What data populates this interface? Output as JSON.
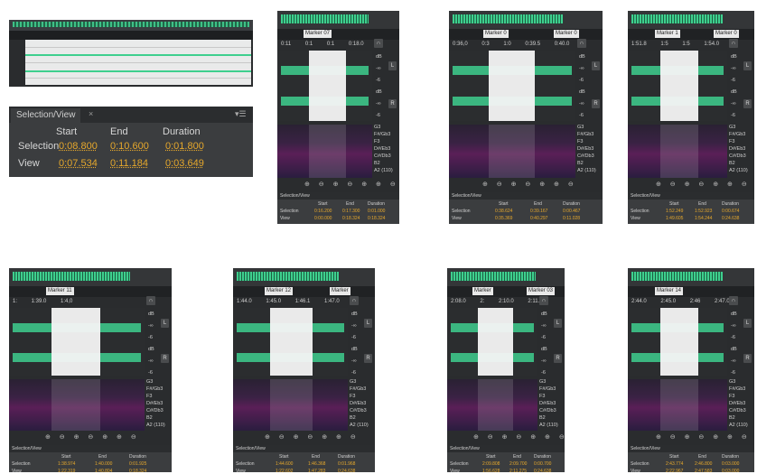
{
  "panel": {
    "tab_label": "Selection/View",
    "tab_close": "×",
    "menu": "▾☰",
    "col_start": "Start",
    "col_end": "End",
    "col_duration": "Duration",
    "row_selection": "Selection",
    "row_view": "View",
    "sel_start": "0:08.800",
    "sel_end": "0:10.600",
    "sel_duration": "0:01.800",
    "view_start": "0:07.534",
    "view_end": "0:11.184",
    "view_duration": "0:03.649"
  },
  "thumbs": [
    {
      "marker": "Marker 07",
      "ticks": [
        "0:11",
        "0:1",
        "0:1",
        "0:18.0"
      ]
    },
    {
      "marker": "Marker 0",
      "ticks": [
        "0:36,0",
        "0:3",
        "1:0",
        "0:39.5",
        "0:40.0"
      ],
      "marker2": "Marker 0"
    },
    {
      "marker": "Marker 1",
      "ticks": [
        "1:51.8",
        "1:5",
        "1:5",
        "1:54.0"
      ],
      "marker2": "Marker 0"
    },
    {
      "marker": "Marker 11",
      "ticks": [
        "1:",
        "1:39.0",
        "1:4,0"
      ]
    },
    {
      "marker": "Marker 12",
      "ticks": [
        "1:44.0",
        "1:45.0",
        "1:46.1",
        "1:47.0"
      ],
      "marker2": "Marker"
    },
    {
      "marker": "Marker",
      "ticks": [
        "2:08.0",
        "2:",
        "2:10.0",
        "2:11.0"
      ],
      "marker2": "Marker 03"
    },
    {
      "marker": "Marker 14",
      "ticks": [
        "2:44.0",
        "2:45.0",
        "2:46",
        "2:47.0"
      ]
    }
  ],
  "spec_labels": [
    "G3",
    "F#/Gb3",
    "F3",
    "D#/Eb3",
    "C#/Db3",
    "B2",
    "A2 (110)"
  ],
  "db_labels": [
    "dB",
    "-∞",
    "-6",
    "dB",
    "-∞",
    "-6"
  ],
  "zoom_icons": "⊕ ⊖ ⊕ ⊖ ⊕ ⊕ ⊖",
  "mini_panel": {
    "tab": "Selection/View",
    "start": "Start",
    "end": "End",
    "duration": "Duration",
    "selection": "Selection",
    "view": "View",
    "rows": [
      {
        "s1": "0:16.200",
        "s2": "0:17.300",
        "s3": "0:01.000",
        "v1": "0:00.000",
        "v2": "0:18.324",
        "v3": "0:18.324"
      },
      {
        "s1": "0:38.624",
        "s2": "0:39.167",
        "s3": "0:00.467",
        "v1": "0:35.369",
        "v2": "0:40.297",
        "v3": "0:11.028"
      },
      {
        "s1": "1:52.249",
        "s2": "1:52.923",
        "s3": "0:00.674",
        "v1": "1:49.605",
        "v2": "1:54.244",
        "v3": "0:24.638"
      },
      {
        "s1": "1:38.974",
        "s2": "1:40.000",
        "s3": "0:01.925",
        "v1": "1:22.319",
        "v2": "1:40.804",
        "v3": "0:18.324"
      },
      {
        "s1": "1:44.600",
        "s2": "1:46.368",
        "s3": "0:01.968",
        "v1": "1:22.602",
        "v2": "1:47.283",
        "v3": "0:24.638"
      },
      {
        "s1": "2:09.808",
        "s2": "2:09.700",
        "s3": "0:00.700",
        "v1": "1:56.628",
        "v2": "2:11.275",
        "v3": "0:24.638"
      },
      {
        "s1": "2:43.774",
        "s2": "2:46.800",
        "s3": "0:03.000",
        "v1": "2:22.967",
        "v2": "2:47.583",
        "v3": "0:03.000"
      }
    ]
  }
}
